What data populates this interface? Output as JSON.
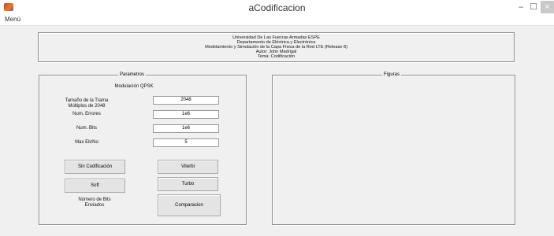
{
  "window": {
    "title": "aCodificacion",
    "minimize": "–",
    "maximize": "☐",
    "close": "×"
  },
  "menu": {
    "item": "Menú"
  },
  "info": {
    "line1": "Universidad De Las Fuerzas Armadas ESPE",
    "line2": "Departamento de Eléctrica y Electrónica",
    "line3": "Modelamiento y Simulación de la Capa Física de la Red LTE (Release 8)",
    "line4": "Autor: John Madrigal",
    "line5": "Tema: Codificación"
  },
  "params": {
    "title": "Parametros",
    "modulation": "Modulación QPSK",
    "frame_label_1": "Tamaño de la Trama",
    "frame_label_2": "Múltiplos de 2048",
    "frame_value": "2048",
    "errors_label": "Num. Errores",
    "errors_value": "1e6",
    "bits_label": "Num. Bits",
    "bits_value": "1e6",
    "ebno_label": "Max Eb/No",
    "ebno_value": "5",
    "btn_sin": "Sin Codificación",
    "btn_viterbi": "Viterbi",
    "btn_soft": "Soft",
    "btn_turbo": "Turbo",
    "sent_label_1": "Número de Bits",
    "sent_label_2": "Enviados",
    "btn_comparacion": "Comparacion"
  },
  "figures": {
    "title": "Figuras"
  }
}
